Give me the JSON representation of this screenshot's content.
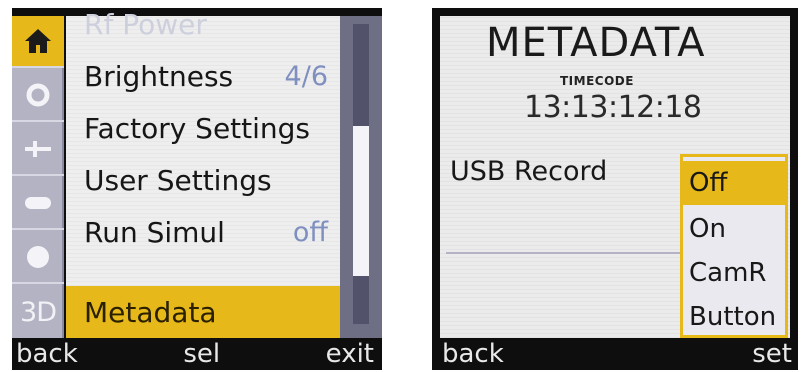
{
  "left_screen": {
    "tabs": [
      {
        "icon": "home-icon",
        "active": true
      },
      {
        "icon": "circle-icon",
        "active": false
      },
      {
        "icon": "connector-icon",
        "active": false
      },
      {
        "icon": "bar-icon",
        "active": false
      },
      {
        "icon": "dot-icon",
        "active": false
      },
      {
        "label": "3D",
        "active": false
      }
    ],
    "menu": [
      {
        "label": "Rf Power",
        "value": "",
        "state": "faded"
      },
      {
        "label": "Brightness",
        "value": "4/6",
        "state": "normal"
      },
      {
        "label": "Factory Settings",
        "value": "",
        "state": "normal"
      },
      {
        "label": "User Settings",
        "value": "",
        "state": "normal"
      },
      {
        "label": "Run Simul",
        "value": "off",
        "state": "normal"
      },
      {
        "label": "Metadata",
        "value": "",
        "state": "selected"
      }
    ],
    "softkeys": {
      "left": "back",
      "center": "sel",
      "right": "exit"
    }
  },
  "right_screen": {
    "title": "METADATA",
    "timecode_label": "TIMECODE",
    "timecode_value": "13:13:12:18",
    "field_label": "USB Record",
    "options": [
      {
        "label": "Off",
        "selected": true
      },
      {
        "label": "On",
        "selected": false
      },
      {
        "label": "CamR",
        "selected": false
      },
      {
        "label": "Button",
        "selected": false
      }
    ],
    "softkeys": {
      "left": "back",
      "right": "set"
    }
  },
  "colors": {
    "highlight": "#e6b81a",
    "panel": "#eeeeef",
    "sidebar": "#b3b3c3",
    "value_text": "#7f8fbf",
    "bezel": "#0e0e0e"
  }
}
